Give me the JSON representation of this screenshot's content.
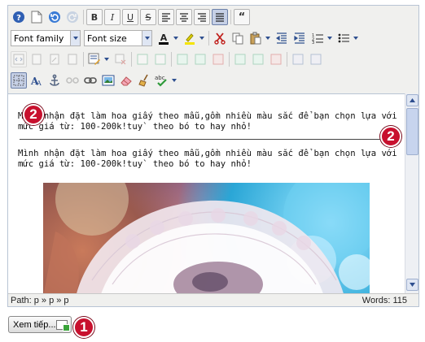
{
  "toolbar": {
    "row1": [
      {
        "name": "help-icon",
        "label": "?",
        "state": "normal"
      },
      {
        "name": "new-document-icon",
        "label": "",
        "state": "normal"
      },
      {
        "name": "undo-icon",
        "label": "↶",
        "state": "normal"
      },
      {
        "name": "redo-icon",
        "label": "↷",
        "state": "disabled"
      },
      {
        "name": "bold-button",
        "label": "B",
        "state": "bordered"
      },
      {
        "name": "italic-button",
        "label": "I",
        "state": "bordered"
      },
      {
        "name": "underline-button",
        "label": "U",
        "state": "bordered"
      },
      {
        "name": "strikethrough-button",
        "label": "S",
        "state": "bordered"
      },
      {
        "name": "align-left-icon",
        "label": "",
        "state": "normal"
      },
      {
        "name": "align-center-icon",
        "label": "",
        "state": "normal"
      },
      {
        "name": "align-right-icon",
        "label": "",
        "state": "normal"
      },
      {
        "name": "align-justify-icon",
        "label": "",
        "state": "active"
      },
      {
        "name": "blockquote-icon",
        "label": "“",
        "state": "bordered"
      }
    ],
    "font_family_label": "Font family",
    "font_size_label": "Font size",
    "colors": {
      "text_color": "#000000",
      "highlight_color": "#f5e400",
      "accent": "#2e4f8f",
      "badge": "#c8102e"
    }
  },
  "content": {
    "paragraph1": "Mình nhận đặt làm hoa giấy theo mẫu,gồm nhiều màu sắc để bạn chọn lựa với mức giá từ: 100-200k!tuy` theo bó to hay nhỏ!",
    "paragraph2": "Mình nhận đặt làm hoa giấy theo mẫu,gồm nhiều màu sắc để bạn chọn lựa với mức giá từ: 100-200k!tuy` theo bó to hay nhỏ!"
  },
  "statusbar": {
    "path": "Path:  p » p » p",
    "words": "Words: 115"
  },
  "badges": {
    "top_left": "2",
    "right": "2",
    "bottom": "1"
  },
  "more_button": {
    "label": "Xem tiếp..."
  }
}
